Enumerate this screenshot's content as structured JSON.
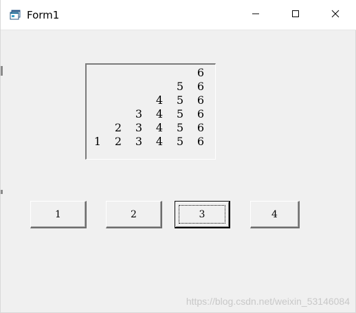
{
  "window": {
    "title": "Form1",
    "controls": {
      "minimize": "minimize",
      "maximize": "maximize",
      "close": "close"
    }
  },
  "picture_box": {
    "rows": [
      [
        "",
        "",
        "",
        "",
        "",
        "6"
      ],
      [
        "",
        "",
        "",
        "",
        "5",
        "6"
      ],
      [
        "",
        "",
        "",
        "4",
        "5",
        "6"
      ],
      [
        "",
        "",
        "3",
        "4",
        "5",
        "6"
      ],
      [
        "",
        "2",
        "3",
        "4",
        "5",
        "6"
      ],
      [
        "1",
        "2",
        "3",
        "4",
        "5",
        "6"
      ]
    ]
  },
  "buttons": [
    {
      "label": "1",
      "focused": false
    },
    {
      "label": "2",
      "focused": false
    },
    {
      "label": "3",
      "focused": true
    },
    {
      "label": "4",
      "focused": false
    }
  ],
  "watermark": "https://blog.csdn.net/weixin_53146084"
}
